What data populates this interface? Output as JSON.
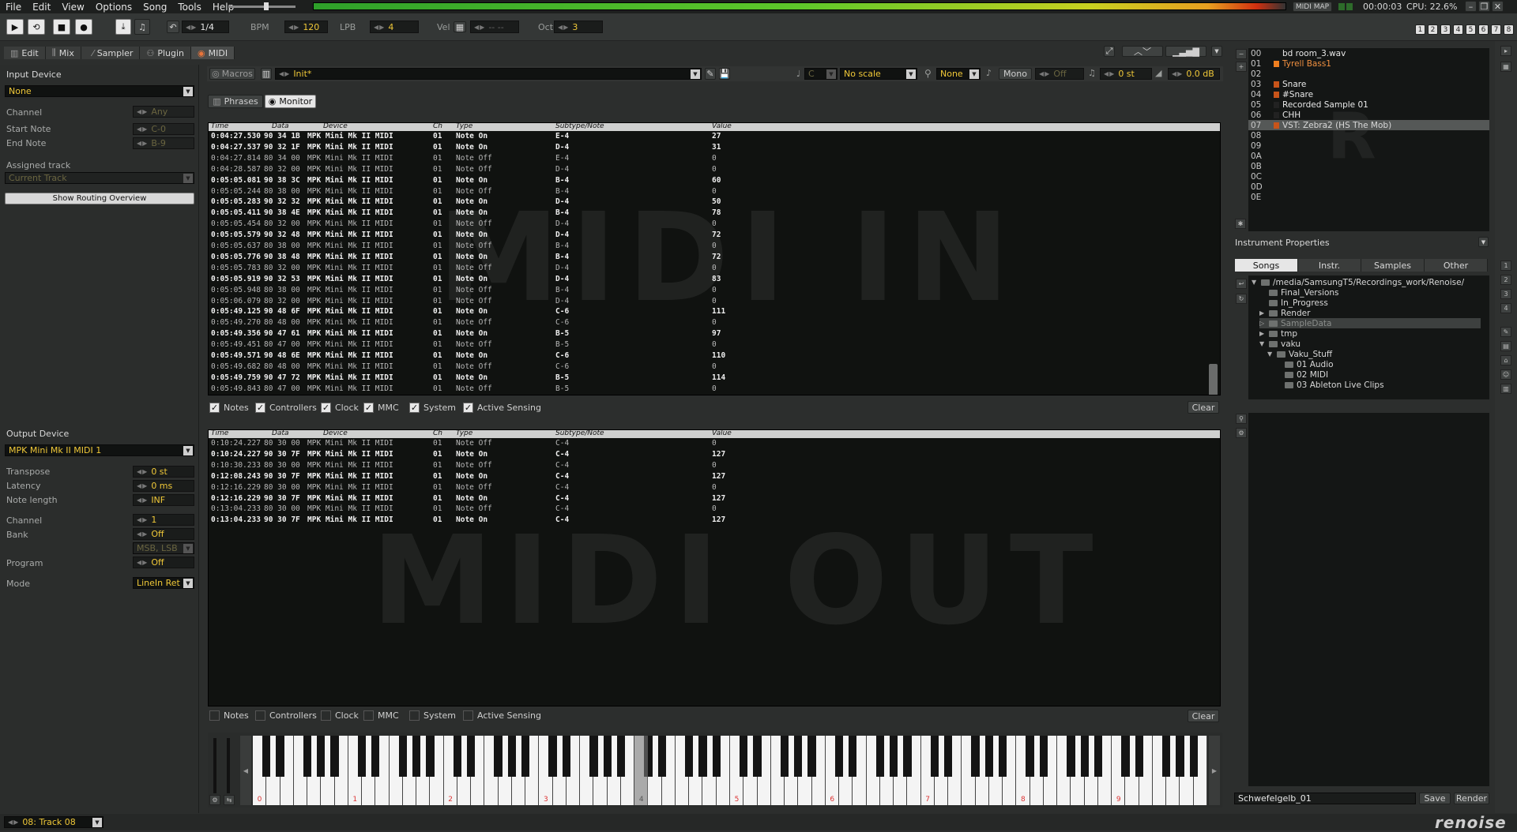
{
  "menu": [
    "File",
    "Edit",
    "View",
    "Options",
    "Song",
    "Tools",
    "Help"
  ],
  "top_status": {
    "midi_map": "MIDI MAP",
    "time": "00:00:03",
    "cpu": "CPU: 22.6%"
  },
  "toolbar": {
    "edit_step": "1/4",
    "bpm_label": "BPM",
    "bpm": "120",
    "lpb_label": "LPB",
    "lpb": "4",
    "vel_label": "Vel",
    "vel": "-- --",
    "oct_label": "Oct",
    "oct": "3",
    "track_nums": [
      "1",
      "2",
      "3",
      "4",
      "5",
      "6",
      "7",
      "8"
    ]
  },
  "tabs": {
    "edit": "Edit",
    "mix": "Mix",
    "sampler": "Sampler",
    "plugin": "Plugin",
    "midi": "MIDI"
  },
  "left": {
    "input_device": "Input Device",
    "input_device_value": "None",
    "channel": "Channel",
    "channel_value": "Any",
    "start_note": "Start Note",
    "start_note_value": "C-0",
    "end_note": "End Note",
    "end_note_value": "B-9",
    "assigned_track": "Assigned track",
    "assigned_track_value": "Current Track",
    "routing_button": "Show Routing Overview",
    "output_device": "Output Device",
    "output_device_value": "MPK Mini Mk II MIDI 1",
    "transpose": "Transpose",
    "transpose_value": "0 st",
    "latency": "Latency",
    "latency_value": "0 ms",
    "note_length": "Note length",
    "note_length_value": "INF",
    "out_channel": "Channel",
    "out_channel_value": "1",
    "bank": "Bank",
    "bank_value": "Off",
    "msb_lsb": "MSB, LSB",
    "program": "Program",
    "program_value": "Off",
    "mode": "Mode",
    "mode_value": "LineIn Ret",
    "track_select": "08: Track 08"
  },
  "instrument_bar": {
    "macros": "Macros",
    "preset": "Init*",
    "key": "C",
    "scale": "No scale",
    "none": "None",
    "mono": "Mono",
    "off": "Off",
    "transpose": "0 st",
    "volume": "0.0 dB"
  },
  "midi_tabs": {
    "phrases": "Phrases",
    "monitor": "Monitor"
  },
  "monitor_headers": {
    "time": "Time",
    "data": "Data",
    "device": "Device",
    "ch": "Ch",
    "type": "Type",
    "subtype": "Subtype/Note",
    "value": "Value"
  },
  "midi_in_label": "MIDI IN",
  "midi_out_label": "MIDI OUT",
  "midi_in_rows": [
    [
      "0:04:27.530",
      "90 34 1B",
      "MPK Mini Mk II MIDI",
      "01",
      "Note On",
      "E-4",
      "27"
    ],
    [
      "0:04:27.537",
      "90 32 1F",
      "MPK Mini Mk II MIDI",
      "01",
      "Note On",
      "D-4",
      "31"
    ],
    [
      "0:04:27.814",
      "80 34 00",
      "MPK Mini Mk II MIDI",
      "01",
      "Note Off",
      "E-4",
      "0"
    ],
    [
      "0:04:28.587",
      "80 32 00",
      "MPK Mini Mk II MIDI",
      "01",
      "Note Off",
      "D-4",
      "0"
    ],
    [
      "0:05:05.081",
      "90 38 3C",
      "MPK Mini Mk II MIDI",
      "01",
      "Note On",
      "B-4",
      "60"
    ],
    [
      "0:05:05.244",
      "80 38 00",
      "MPK Mini Mk II MIDI",
      "01",
      "Note Off",
      "B-4",
      "0"
    ],
    [
      "0:05:05.283",
      "90 32 32",
      "MPK Mini Mk II MIDI",
      "01",
      "Note On",
      "D-4",
      "50"
    ],
    [
      "0:05:05.411",
      "90 38 4E",
      "MPK Mini Mk II MIDI",
      "01",
      "Note On",
      "B-4",
      "78"
    ],
    [
      "0:05:05.454",
      "80 32 00",
      "MPK Mini Mk II MIDI",
      "01",
      "Note Off",
      "D-4",
      "0"
    ],
    [
      "0:05:05.579",
      "90 32 48",
      "MPK Mini Mk II MIDI",
      "01",
      "Note On",
      "D-4",
      "72"
    ],
    [
      "0:05:05.637",
      "80 38 00",
      "MPK Mini Mk II MIDI",
      "01",
      "Note Off",
      "B-4",
      "0"
    ],
    [
      "0:05:05.776",
      "90 38 48",
      "MPK Mini Mk II MIDI",
      "01",
      "Note On",
      "B-4",
      "72"
    ],
    [
      "0:05:05.783",
      "80 32 00",
      "MPK Mini Mk II MIDI",
      "01",
      "Note Off",
      "D-4",
      "0"
    ],
    [
      "0:05:05.919",
      "90 32 53",
      "MPK Mini Mk II MIDI",
      "01",
      "Note On",
      "D-4",
      "83"
    ],
    [
      "0:05:05.948",
      "80 38 00",
      "MPK Mini Mk II MIDI",
      "01",
      "Note Off",
      "B-4",
      "0"
    ],
    [
      "0:05:06.079",
      "80 32 00",
      "MPK Mini Mk II MIDI",
      "01",
      "Note Off",
      "D-4",
      "0"
    ],
    [
      "0:05:49.125",
      "90 48 6F",
      "MPK Mini Mk II MIDI",
      "01",
      "Note On",
      "C-6",
      "111"
    ],
    [
      "0:05:49.270",
      "80 48 00",
      "MPK Mini Mk II MIDI",
      "01",
      "Note Off",
      "C-6",
      "0"
    ],
    [
      "0:05:49.356",
      "90 47 61",
      "MPK Mini Mk II MIDI",
      "01",
      "Note On",
      "B-5",
      "97"
    ],
    [
      "0:05:49.451",
      "80 47 00",
      "MPK Mini Mk II MIDI",
      "01",
      "Note Off",
      "B-5",
      "0"
    ],
    [
      "0:05:49.571",
      "90 48 6E",
      "MPK Mini Mk II MIDI",
      "01",
      "Note On",
      "C-6",
      "110"
    ],
    [
      "0:05:49.682",
      "80 48 00",
      "MPK Mini Mk II MIDI",
      "01",
      "Note Off",
      "C-6",
      "0"
    ],
    [
      "0:05:49.759",
      "90 47 72",
      "MPK Mini Mk II MIDI",
      "01",
      "Note On",
      "B-5",
      "114"
    ],
    [
      "0:05:49.843",
      "80 47 00",
      "MPK Mini Mk II MIDI",
      "01",
      "Note Off",
      "B-5",
      "0"
    ]
  ],
  "midi_out_rows": [
    [
      "0:10:24.227",
      "80 30 00",
      "MPK Mini Mk II MIDI",
      "01",
      "Note Off",
      "C-4",
      "0"
    ],
    [
      "0:10:24.227",
      "90 30 7F",
      "MPK Mini Mk II MIDI",
      "01",
      "Note On",
      "C-4",
      "127"
    ],
    [
      "0:10:30.233",
      "80 30 00",
      "MPK Mini Mk II MIDI",
      "01",
      "Note Off",
      "C-4",
      "0"
    ],
    [
      "0:12:08.243",
      "90 30 7F",
      "MPK Mini Mk II MIDI",
      "01",
      "Note On",
      "C-4",
      "127"
    ],
    [
      "0:12:16.229",
      "80 30 00",
      "MPK Mini Mk II MIDI",
      "01",
      "Note Off",
      "C-4",
      "0"
    ],
    [
      "0:12:16.229",
      "90 30 7F",
      "MPK Mini Mk II MIDI",
      "01",
      "Note On",
      "C-4",
      "127"
    ],
    [
      "0:13:04.233",
      "80 30 00",
      "MPK Mini Mk II MIDI",
      "01",
      "Note Off",
      "C-4",
      "0"
    ],
    [
      "0:13:04.233",
      "90 30 7F",
      "MPK Mini Mk II MIDI",
      "01",
      "Note On",
      "C-4",
      "127"
    ]
  ],
  "filters": [
    "Notes",
    "Controllers",
    "Clock",
    "MMC",
    "System",
    "Active Sensing"
  ],
  "filters_in_checked": [
    true,
    true,
    true,
    true,
    true,
    true
  ],
  "filters_out_checked": [
    false,
    false,
    false,
    false,
    false,
    false
  ],
  "clear": "Clear",
  "instruments": [
    {
      "num": "00",
      "name": "bd room_3.wav",
      "color": "",
      "selected": false
    },
    {
      "num": "01",
      "name": "Tyrell Bass1",
      "color": "#f07f20",
      "selected": false
    },
    {
      "num": "02",
      "name": "",
      "color": "",
      "selected": false
    },
    {
      "num": "03",
      "name": "Snare",
      "color": "#c8541a",
      "selected": false
    },
    {
      "num": "04",
      "name": "#Snare",
      "color": "#c8541a",
      "selected": false
    },
    {
      "num": "05",
      "name": "Recorded Sample 01",
      "color": "#222",
      "selected": false
    },
    {
      "num": "06",
      "name": "CHH",
      "color": "#222",
      "selected": false
    },
    {
      "num": "07",
      "name": "VST: Zebra2 (HS The Mob)",
      "color": "#c8541a",
      "selected": true
    },
    {
      "num": "08",
      "name": "",
      "color": "",
      "selected": false
    },
    {
      "num": "09",
      "name": "",
      "color": "",
      "selected": false
    },
    {
      "num": "0A",
      "name": "",
      "color": "",
      "selected": false
    },
    {
      "num": "0B",
      "name": "",
      "color": "",
      "selected": false
    },
    {
      "num": "0C",
      "name": "",
      "color": "",
      "selected": false
    },
    {
      "num": "0D",
      "name": "",
      "color": "",
      "selected": false
    },
    {
      "num": "0E",
      "name": "",
      "color": "",
      "selected": false
    }
  ],
  "instrument_properties": "Instrument Properties",
  "browser_tabs": [
    "Songs",
    "Instr.",
    "Samples",
    "Other"
  ],
  "browser_tree": [
    {
      "label": "/media/SamsungT5/Recordings_work/Renoise/",
      "depth": 0,
      "arrow": "▼"
    },
    {
      "label": "Final_Versions",
      "depth": 1,
      "arrow": ""
    },
    {
      "label": "In_Progress",
      "depth": 1,
      "arrow": ""
    },
    {
      "label": "Render",
      "depth": 1,
      "arrow": "▶"
    },
    {
      "label": "SampleData",
      "depth": 1,
      "arrow": "▷"
    },
    {
      "label": "tmp",
      "depth": 1,
      "arrow": "▶"
    },
    {
      "label": "vaku",
      "depth": 1,
      "arrow": "▼"
    },
    {
      "label": "Vaku_Stuff",
      "depth": 2,
      "arrow": "▼"
    },
    {
      "label": "01 Audio",
      "depth": 3,
      "arrow": ""
    },
    {
      "label": "02 MIDI",
      "depth": 3,
      "arrow": ""
    },
    {
      "label": "03 Ableton Live Clips",
      "depth": 3,
      "arrow": ""
    }
  ],
  "song_name": "Schwefelgelb_01",
  "save": "Save",
  "render": "Render",
  "octave_labels": [
    "0",
    "1",
    "2",
    "3",
    "4",
    "5",
    "6",
    "7",
    "8",
    "9"
  ],
  "logo": "renoise"
}
